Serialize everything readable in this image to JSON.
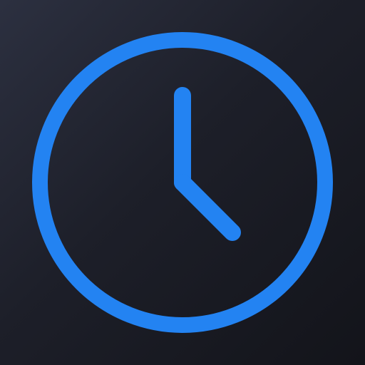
{
  "icon": {
    "name": "clock-icon",
    "accent_color": "#2383f2",
    "background_color": "#1d1f29"
  }
}
